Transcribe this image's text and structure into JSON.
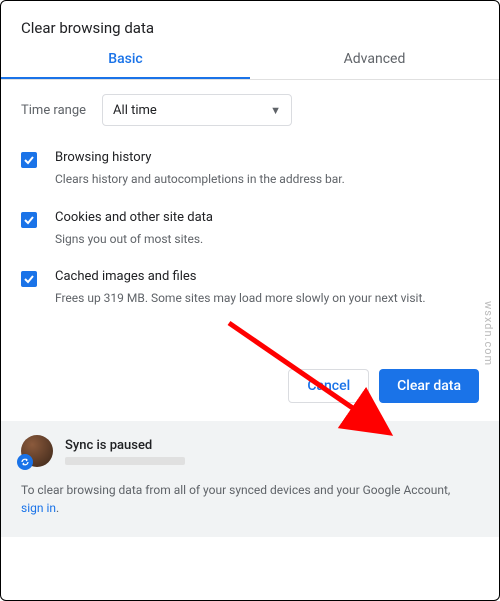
{
  "title": "Clear browsing data",
  "tabs": {
    "basic": "Basic",
    "advanced": "Advanced"
  },
  "time": {
    "label": "Time range",
    "value": "All time"
  },
  "options": {
    "history": {
      "title": "Browsing history",
      "desc": "Clears history and autocompletions in the address bar."
    },
    "cookies": {
      "title": "Cookies and other site data",
      "desc": "Signs you out of most sites."
    },
    "cache": {
      "title": "Cached images and files",
      "desc": "Frees up 319 MB. Some sites may load more slowly on your next visit."
    }
  },
  "actions": {
    "cancel": "Cancel",
    "clear": "Clear data"
  },
  "sync": {
    "status": "Sync is paused",
    "note_prefix": "To clear browsing data from all of your synced devices and your Google Account, ",
    "signin": "sign in",
    "note_suffix": "."
  },
  "watermark": "wsxdn.com"
}
